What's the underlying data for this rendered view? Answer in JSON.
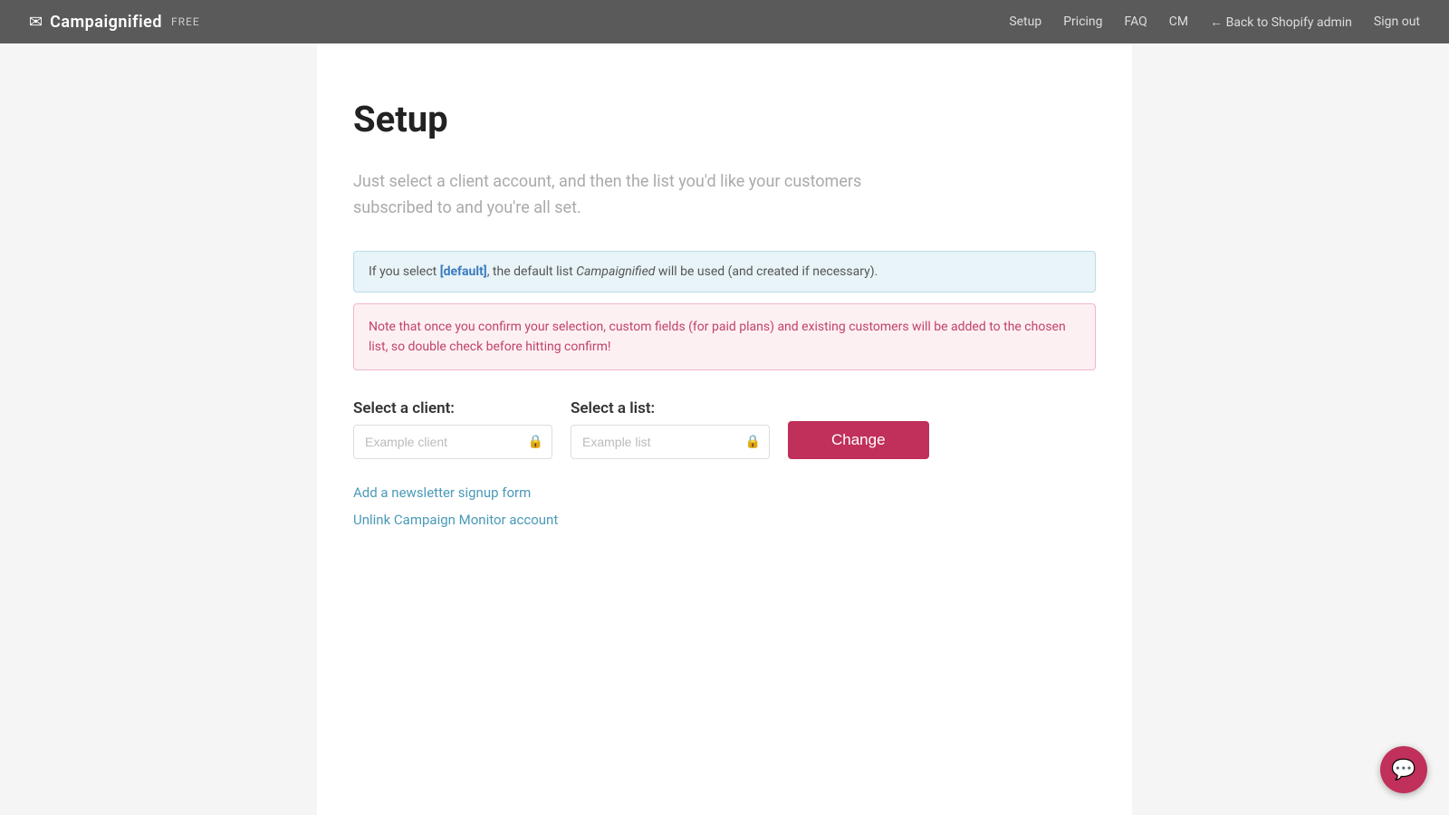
{
  "header": {
    "logo_icon": "✉",
    "logo_text": "Campaignified",
    "logo_badge": "FREE",
    "nav": {
      "setup": "Setup",
      "pricing": "Pricing",
      "faq": "FAQ",
      "cm": "CM",
      "back_to_shopify": "← Back to Shopify admin",
      "sign_out": "Sign out"
    }
  },
  "main": {
    "page_title": "Setup",
    "page_description": "Just select a client account, and then the list you'd like your customers subscribed to and you're all set.",
    "alert_info": {
      "prefix": "If you select ",
      "keyword": "[default]",
      "suffix": ", the default list ",
      "brand": "Campaignified",
      "suffix2": " will be used (and created if necessary)."
    },
    "alert_warning": "Note that once you confirm your selection, custom fields (for paid plans) and existing customers will be added to the chosen list, so double check before hitting confirm!",
    "client_label": "Select a client:",
    "client_placeholder": "Example client",
    "list_label": "Select a list:",
    "list_placeholder": "Example list",
    "change_button": "Change",
    "add_newsletter_link": "Add a newsletter signup form",
    "unlink_link": "Unlink Campaign Monitor account"
  },
  "chat": {
    "icon": "💬"
  }
}
